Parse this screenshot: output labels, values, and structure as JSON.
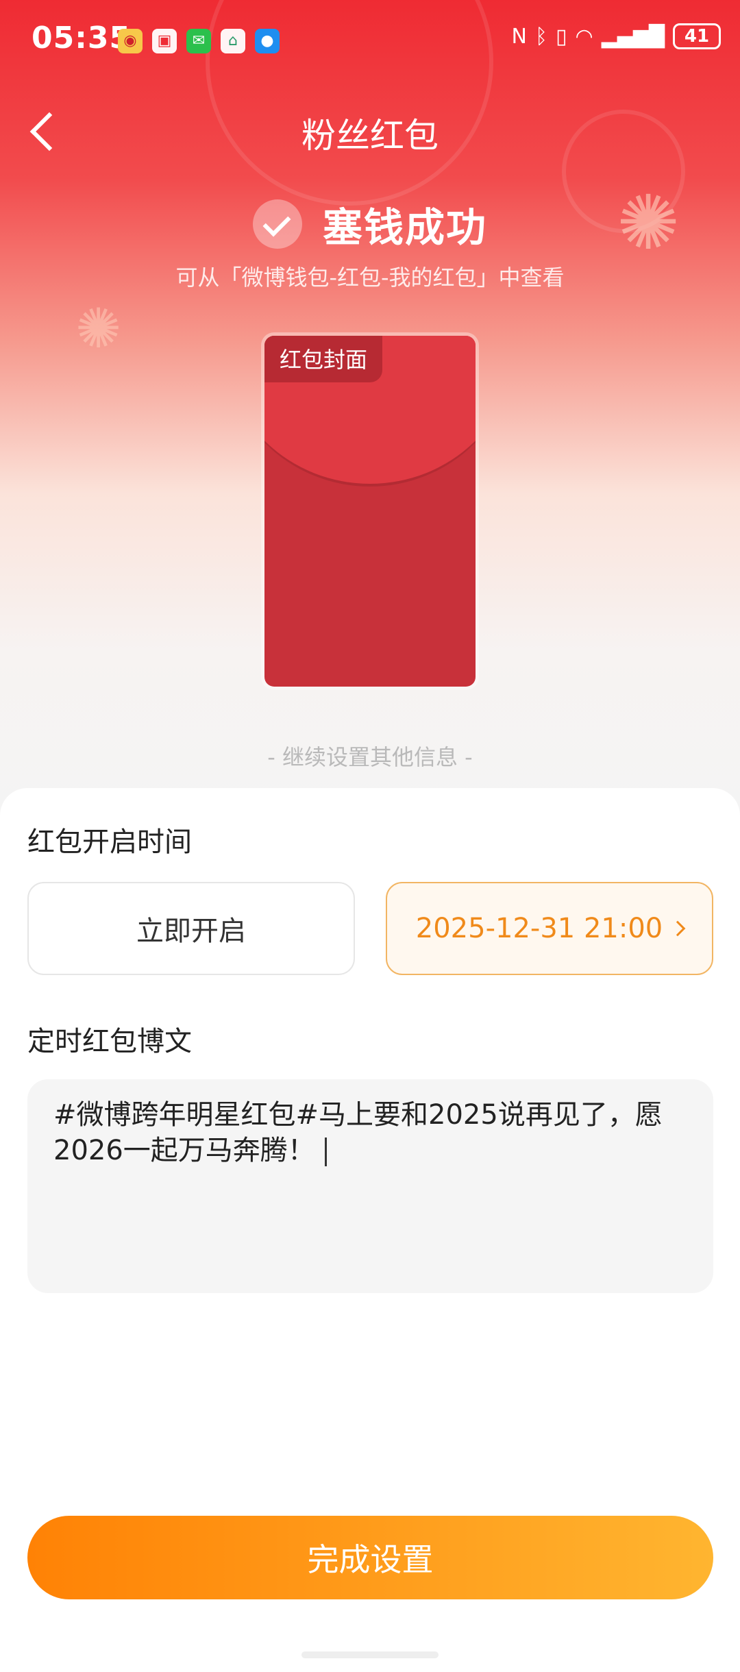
{
  "status_bar": {
    "time": "05:35",
    "battery": "41",
    "icons": [
      "weibo-icon",
      "red-notes-icon",
      "wechat-icon",
      "home-app-icon",
      "message-icon",
      "nfc-icon",
      "bluetooth-icon",
      "vibrate-icon",
      "wifi-icon",
      "signal-icon",
      "battery-icon"
    ]
  },
  "nav": {
    "title": "粉丝红包"
  },
  "success": {
    "title": "塞钱成功",
    "hint": "可从「微博钱包-红包-我的红包」中查看"
  },
  "envelope": {
    "tag": "红包封面"
  },
  "continue_hint": "- 继续设置其他信息 -",
  "open_time": {
    "title": "红包开启时间",
    "option_now": "立即开启",
    "option_scheduled": "2025-12-31 21:00"
  },
  "post": {
    "title": "定时红包博文",
    "content": "#微博跨年明星红包#马上要和2025说再见了，愿2026一起万马奔腾！"
  },
  "done_button": "完成设置",
  "colors": {
    "brand_red": "#ef2b33",
    "accent_orange": "#f08a1a",
    "button_gradient_start": "#ff8205",
    "button_gradient_end": "#ffb530"
  }
}
